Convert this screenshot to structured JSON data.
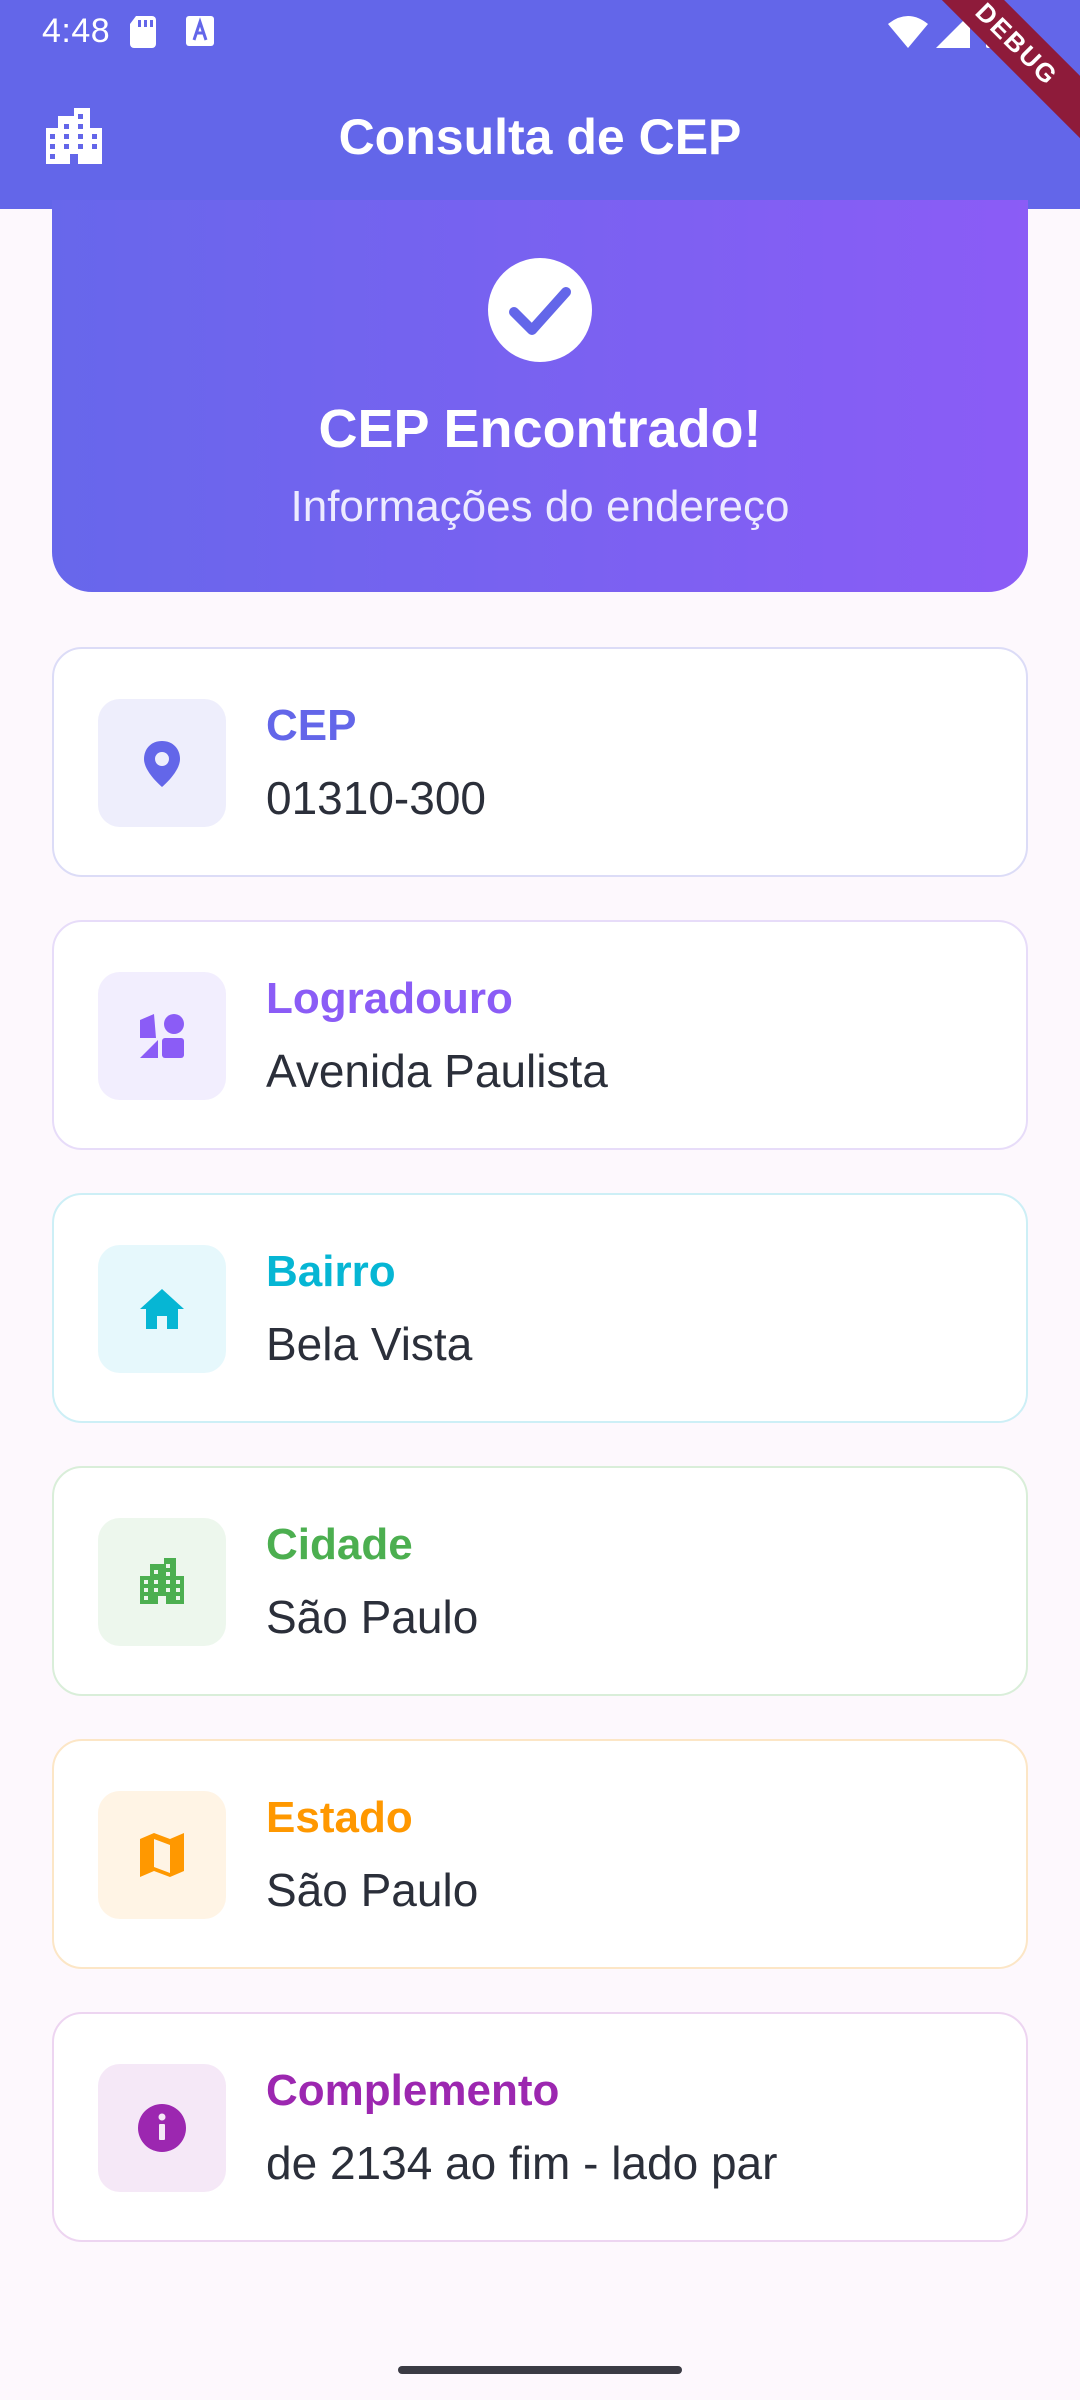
{
  "status_bar": {
    "time": "4:48",
    "icons": [
      "sd-card-icon",
      "a-icon",
      "wifi-icon",
      "signal-icon",
      "battery-icon"
    ],
    "debug_banner": "DEBUG"
  },
  "app_bar": {
    "title": "Consulta de CEP",
    "leading_icon": "apartment-icon",
    "color": "#6366E9"
  },
  "result_header": {
    "icon": "check-circle-icon",
    "title": "CEP Encontrado!",
    "subtitle": "Informações do endereço"
  },
  "fields": [
    {
      "label": "CEP",
      "value": "01310-300",
      "icon": "location-pin-icon",
      "accent": "#6366E9"
    },
    {
      "label": "Logradouro",
      "value": "Avenida Paulista",
      "icon": "interests-icon",
      "accent": "#8B5CF6"
    },
    {
      "label": "Bairro",
      "value": "Bela Vista",
      "icon": "home-icon",
      "accent": "#06B6D4"
    },
    {
      "label": "Cidade",
      "value": "São Paulo",
      "icon": "city-icon",
      "accent": "#4CAF50"
    },
    {
      "label": "Estado",
      "value": "São Paulo",
      "icon": "map-icon",
      "accent": "#FF9800"
    },
    {
      "label": "Complemento",
      "value": "de 2134 ao fim - lado par",
      "icon": "info-icon",
      "accent": "#9C27B0"
    }
  ]
}
